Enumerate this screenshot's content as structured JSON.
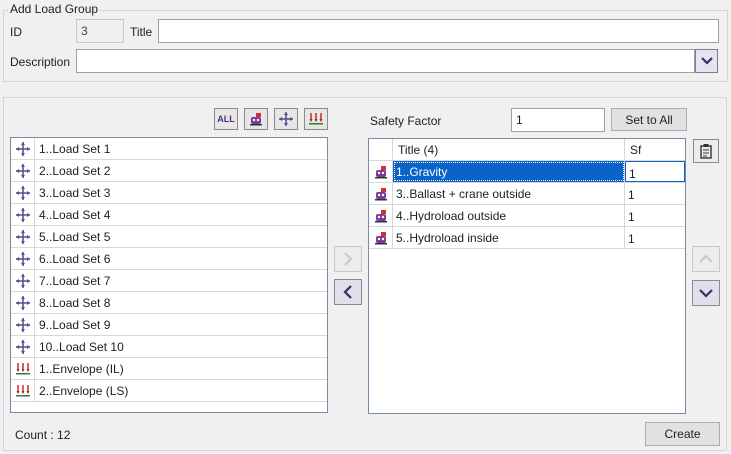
{
  "group": {
    "legend": "Add Load Group",
    "id_label": "ID",
    "id_value": "3",
    "title_label": "Title",
    "title_value": "",
    "description_label": "Description",
    "description_value": ""
  },
  "left_toolbar": {
    "all_label": "ALL"
  },
  "safety": {
    "label": "Safety Factor",
    "value": "1",
    "set_all_label": "Set to All"
  },
  "load_sets": [
    {
      "label": "1..Load Set 1",
      "icon": "load-set-icon"
    },
    {
      "label": "2..Load Set 2",
      "icon": "load-set-icon"
    },
    {
      "label": "3..Load Set 3",
      "icon": "load-set-icon"
    },
    {
      "label": "4..Load Set 4",
      "icon": "load-set-icon"
    },
    {
      "label": "5..Load Set 5",
      "icon": "load-set-icon"
    },
    {
      "label": "6..Load Set 6",
      "icon": "load-set-icon"
    },
    {
      "label": "7..Load Set 7",
      "icon": "load-set-icon"
    },
    {
      "label": "8..Load Set 8",
      "icon": "load-set-icon"
    },
    {
      "label": "9..Load Set 9",
      "icon": "load-set-icon"
    },
    {
      "label": "10..Load Set 10",
      "icon": "load-set-icon"
    },
    {
      "label": "1..Envelope (IL)",
      "icon": "envelope-icon"
    },
    {
      "label": "2..Envelope (LS)",
      "icon": "envelope-icon"
    }
  ],
  "grid": {
    "title_header": "Title (4)",
    "sf_header": "Sf",
    "rows": [
      {
        "title": "1..Gravity",
        "sf": "1",
        "selected": true
      },
      {
        "title": "3..Ballast + crane outside",
        "sf": "1",
        "selected": false
      },
      {
        "title": "4..Hydroload outside",
        "sf": "1",
        "selected": false
      },
      {
        "title": "5..Hydroload inside",
        "sf": "1",
        "selected": false
      }
    ]
  },
  "footer": {
    "count_text": "Count : 12",
    "create_label": "Create"
  }
}
